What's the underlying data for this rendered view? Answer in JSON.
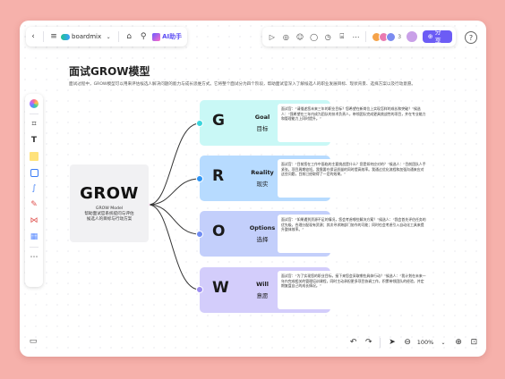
{
  "app": {
    "name": "boardmix",
    "ai_label": "AI助手",
    "share_label": "分享",
    "collab_count": "3",
    "zoom": "100%"
  },
  "doc": {
    "title": "面试GROW模型",
    "description": "面试过程中，GROW模型可以用来评估候选人解决问题的能力与成长思维方式。它将整个面试分为四个阶段，帮助面试官深入了解候选人的职业发展目标、现状背景、选择方案以及行动意愿。"
  },
  "center": {
    "title": "GROW",
    "subtitle_line1": "GROW Model",
    "subtitle_line2": "帮助面试官系统提问与评估",
    "subtitle_line3": "候选人的目标与行动方案"
  },
  "branches": [
    {
      "letter": "G",
      "en": "Goal",
      "zh": "目标",
      "bg": "#c9f8f6",
      "dot": "#3ad5dc",
      "note": "面试官：“请描述您未来三年的职业目标？您希望在新岗位上实现怎样的成长和突破？”候选人：“我希望在三年内成为团队的技术负责人，带领团队完成更具挑战性的项目，并在专业能力和管理能力上同时提升。”"
    },
    {
      "letter": "R",
      "en": "Reality",
      "zh": "现实",
      "bg": "#b7dbff",
      "dot": "#2e95f5",
      "note": "面试官：“目前您在工作中面临的主要挑战是什么？您是如何应对的？”候选人：“目前团队人手紧张，项目周期较短，我需要在保证质量的同时提高效率。我通过优化流程和加强沟通来应对这些问题，目前已经取得了一定的效果。”"
    },
    {
      "letter": "O",
      "en": "Options",
      "zh": "选择",
      "bg": "#c3cffb",
      "dot": "#6f8bf2",
      "note": "面试官：“如果遇到资源不足的情况，您会考虑哪些解决方案？”候选人：“我会首先评估任务的优先级，合理分配现有资源；其次寻求跨部门协作的可能；同时也会考虑引入自动化工具来提升整体效率。”"
    },
    {
      "letter": "W",
      "en": "Will",
      "zh": "意愿",
      "bg": "#d3cdfb",
      "dot": "#9b8cf0",
      "note": "面试官：“为了实现您的职业目标，接下来您会采取哪些具体行动？”候选人：“我计划在未来一年内完成相关的管理培训课程，同时主动承担更多项目协调工作，积累带领团队的经验，并定期复盘自己的成长情况。”"
    }
  ]
}
